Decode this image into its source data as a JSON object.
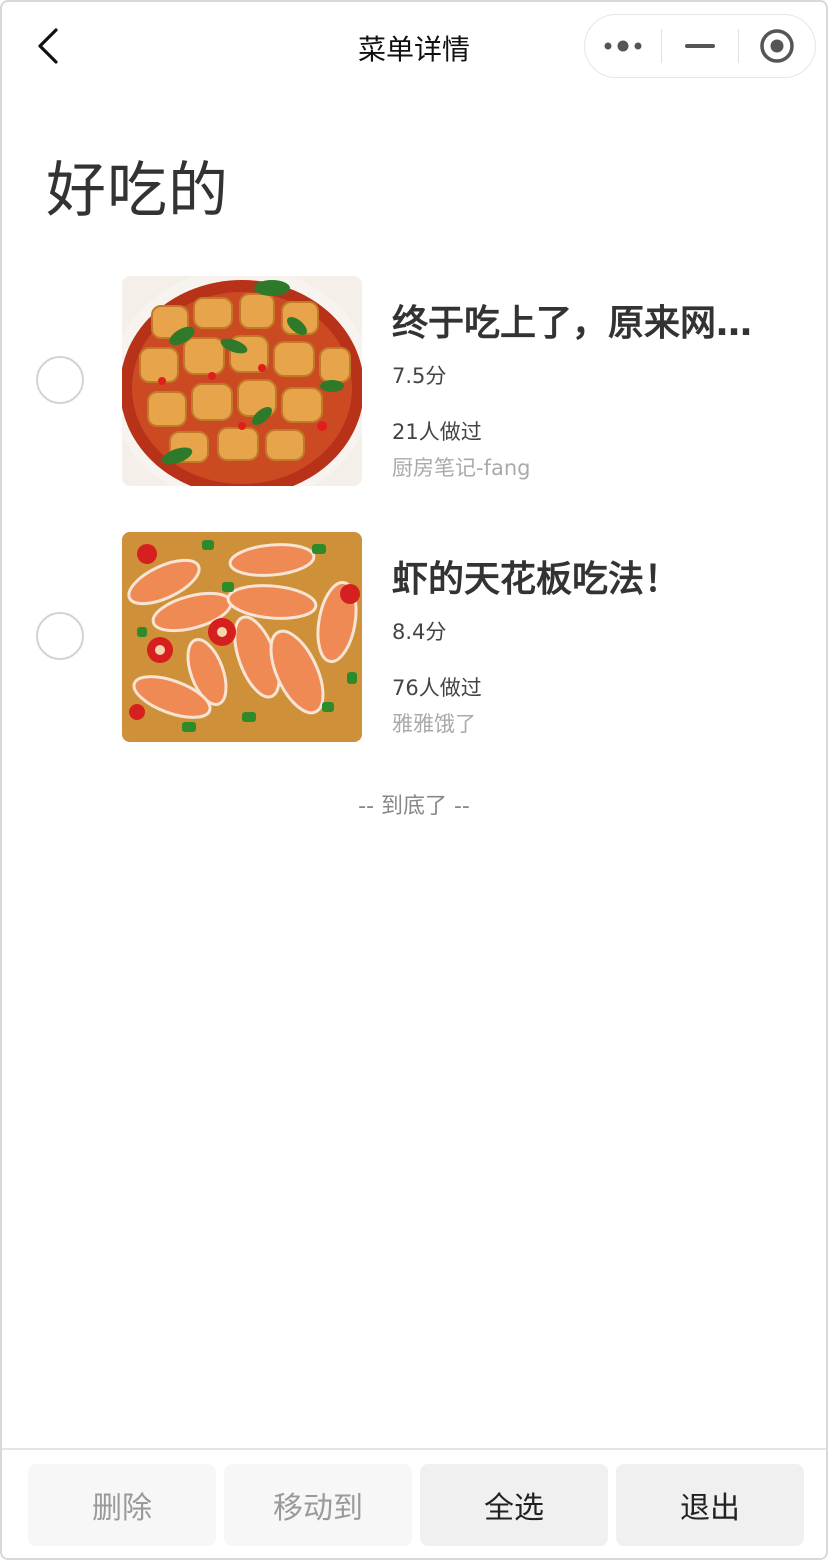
{
  "nav": {
    "title": "菜单详情",
    "back_icon": "chevron-left-icon",
    "more_icon": "more-dots-icon",
    "minimize_icon": "minimize-icon",
    "close_icon": "record-circle-icon"
  },
  "page": {
    "title": "好吃的",
    "end_text": "-- 到底了 --"
  },
  "recipes": [
    {
      "title": "终于吃上了，原来网…",
      "score": "7.5分",
      "made_count": "21人做过",
      "author": "厨房笔记-fang",
      "image": "braised-tofu-chili-dish"
    },
    {
      "title": "虾的天花板吃法！",
      "score": "8.4分",
      "made_count": "76人做过",
      "author": "雅雅饿了",
      "image": "shrimp-in-chili-broth-dish"
    }
  ],
  "footer": {
    "delete_label": "删除",
    "move_label": "移动到",
    "select_all_label": "全选",
    "exit_label": "退出"
  },
  "colors": {
    "disabled_text": "#9a9a9a",
    "secondary_text": "#aaaaaa",
    "title_text": "#333333"
  }
}
